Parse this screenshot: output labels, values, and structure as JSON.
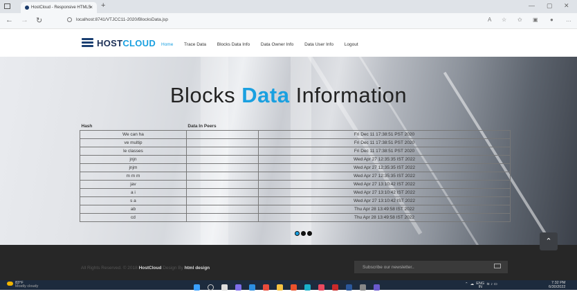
{
  "browser": {
    "tab_title": "HostCloud - Responsive HTML5",
    "tab_close": "×",
    "new_tab": "+",
    "url": "localhost:8741/VTJCC11-2020/BlocksData.jsp",
    "minimize": "—",
    "maximize": "▢",
    "close": "✕"
  },
  "header": {
    "logo_host": "HOST",
    "logo_cloud": "CLOUD",
    "nav": [
      "Home",
      "Trace Data",
      "Blocks Data Info",
      "Data Owner Info",
      "Data User Info",
      "Logout"
    ],
    "active_nav": "Home"
  },
  "hero": {
    "title_part1": "Blocks ",
    "title_accent": "Data",
    "title_part2": " Information"
  },
  "table": {
    "columns": [
      "Hash",
      "Data In Peers",
      ""
    ],
    "rows": [
      [
        "We can ha",
        "",
        "Fri Dec 11 17:38:51 PST 2020"
      ],
      [
        "ve multip",
        "",
        "Fri Dec 11 17:38:51 PST 2020"
      ],
      [
        "le classes",
        "",
        "Fri Dec 11 17:38:51 PST 2020"
      ],
      [
        "jnjn",
        "",
        "Wed Apr 27 12:35:35 IST 2022"
      ],
      [
        "jnjm",
        "",
        "Wed Apr 27 12:35:35 IST 2022"
      ],
      [
        "m m m",
        "",
        "Wed Apr 27 12:35:35 IST 2022"
      ],
      [
        "jav",
        "",
        "Wed Apr 27 13:10:42 IST 2022"
      ],
      [
        "a i",
        "",
        "Wed Apr 27 13:10:42 IST 2022"
      ],
      [
        "s a",
        "",
        "Wed Apr 27 13:10:42 IST 2022"
      ],
      [
        "ab",
        "",
        "Thu Apr 28 13:49:58 IST 2022"
      ],
      [
        "cd",
        "",
        "Thu Apr 28 13:49:58 IST 2022"
      ]
    ]
  },
  "footer": {
    "copyright_prefix": "All Rights Reserved. © 2018 ",
    "brand": "HostCloud",
    "design_by": " Design By ",
    "designer": "html design",
    "newsletter_placeholder": "Subscribe our newsletter..",
    "to_top": "⌃"
  },
  "taskbar": {
    "temperature": "83°F",
    "weather": "Mostly cloudy",
    "lang_top": "ENG",
    "lang_bottom": "IN",
    "time": "7:32 PM",
    "date": "6/30/2022"
  }
}
